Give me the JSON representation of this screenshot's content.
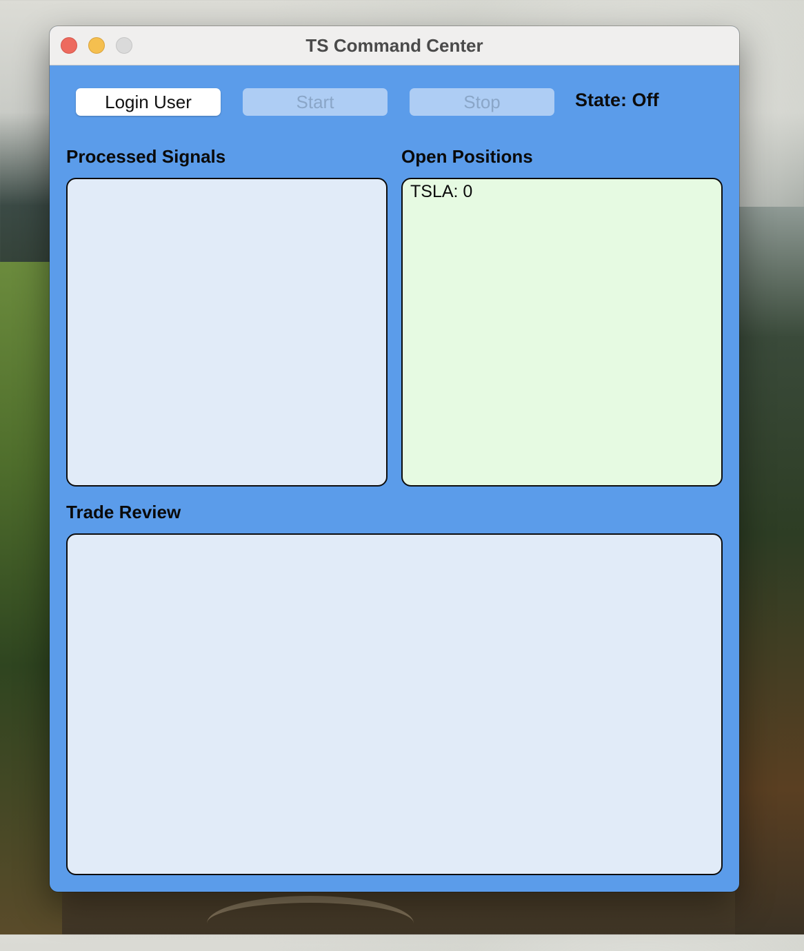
{
  "window": {
    "title": "TS Command Center"
  },
  "toolbar": {
    "login_label": "Login User",
    "start_label": "Start",
    "stop_label": "Stop",
    "state_text": "State: Off"
  },
  "sections": {
    "processed_signals": {
      "title": "Processed Signals",
      "items": []
    },
    "open_positions": {
      "title": "Open Positions",
      "items": [
        "TSLA: 0"
      ]
    },
    "trade_review": {
      "title": "Trade Review",
      "items": []
    }
  }
}
